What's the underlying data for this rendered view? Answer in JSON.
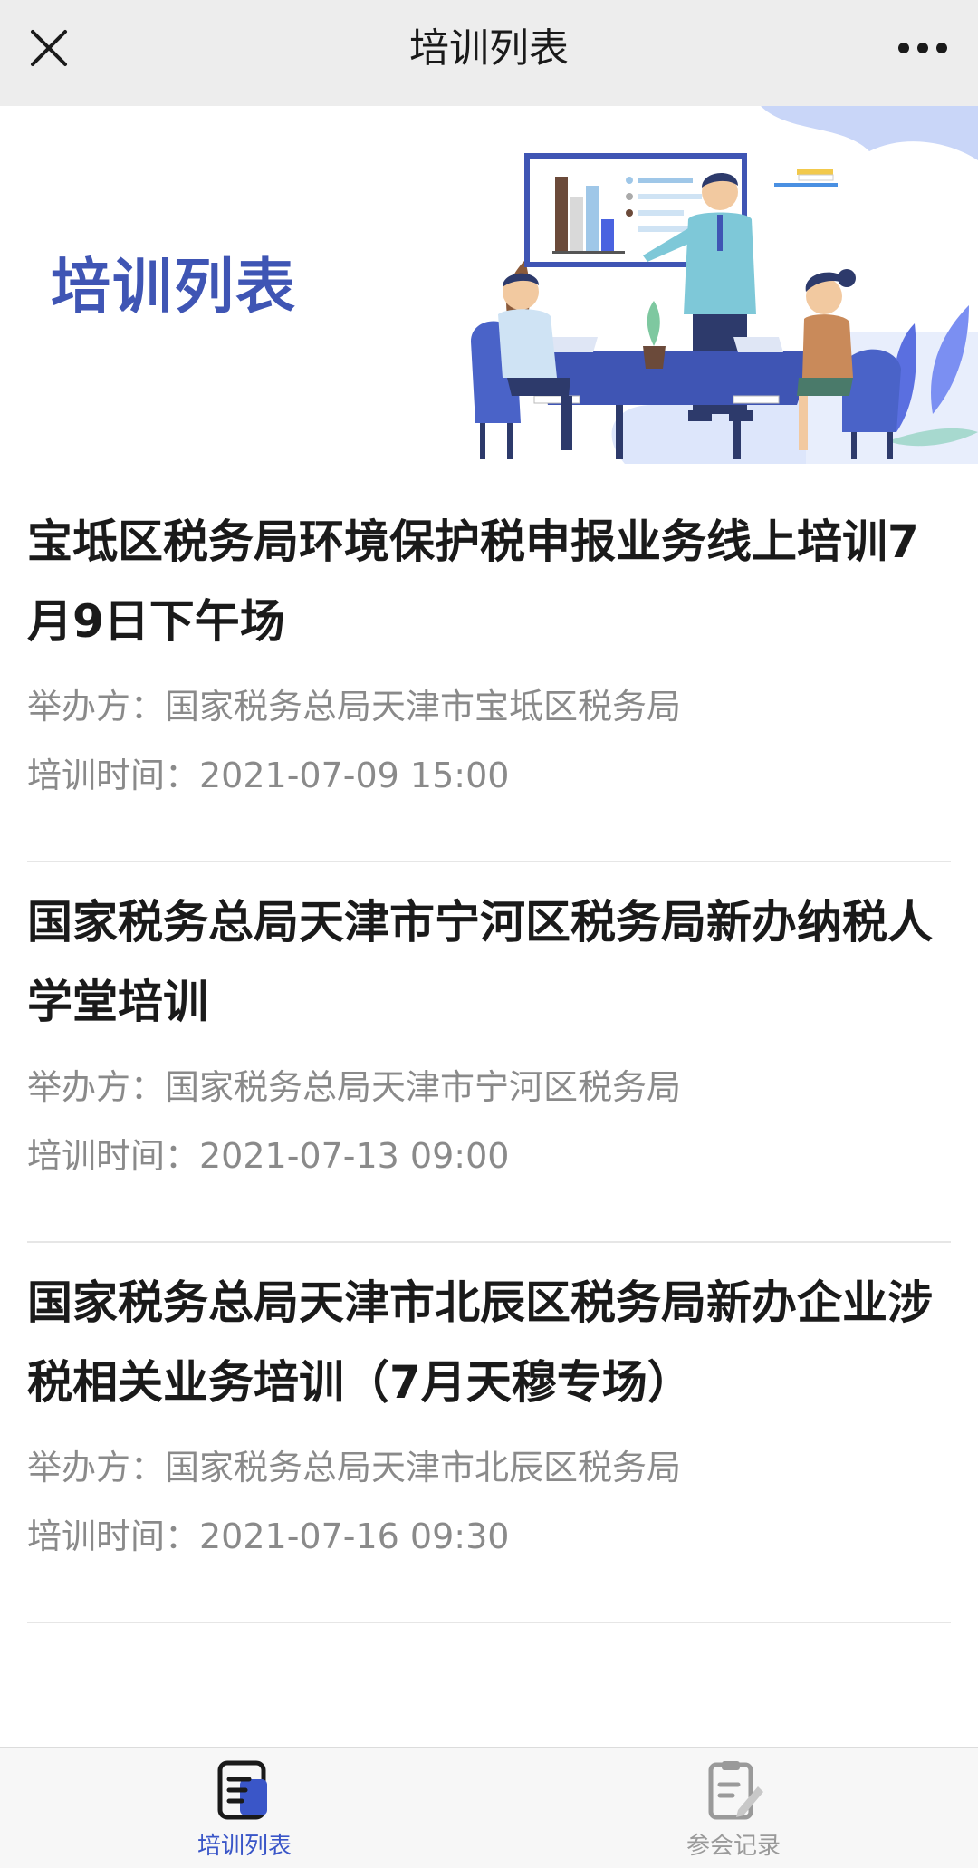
{
  "navbar": {
    "title": "培训列表",
    "close_icon": "close-icon",
    "more_icon": "more-icon"
  },
  "banner": {
    "title": "培训列表",
    "accent_color": "#3f55b4"
  },
  "trainings": [
    {
      "title": "宝坻区税务局环境保护税申报业务线上培训7月9日下午场",
      "organizer": "举办方：国家税务总局天津市宝坻区税务局",
      "time": "培训时间：2021-07-09 15:00"
    },
    {
      "title": "国家税务总局天津市宁河区税务局新办纳税人学堂培训",
      "organizer": "举办方：国家税务总局天津市宁河区税务局",
      "time": "培训时间：2021-07-13 09:00"
    },
    {
      "title": "国家税务总局天津市北辰区税务局新办企业涉税相关业务培训（7月天穆专场）",
      "organizer": "举办方：国家税务总局天津市北辰区税务局",
      "time": "培训时间：2021-07-16 09:30"
    }
  ],
  "tabbar": {
    "tabs": [
      {
        "label": "培训列表",
        "icon": "training-list-icon",
        "active": true
      },
      {
        "label": "参会记录",
        "icon": "attendance-record-icon",
        "active": false
      }
    ],
    "active_color": "#3a56c8",
    "inactive_color": "#9a9a9a"
  }
}
